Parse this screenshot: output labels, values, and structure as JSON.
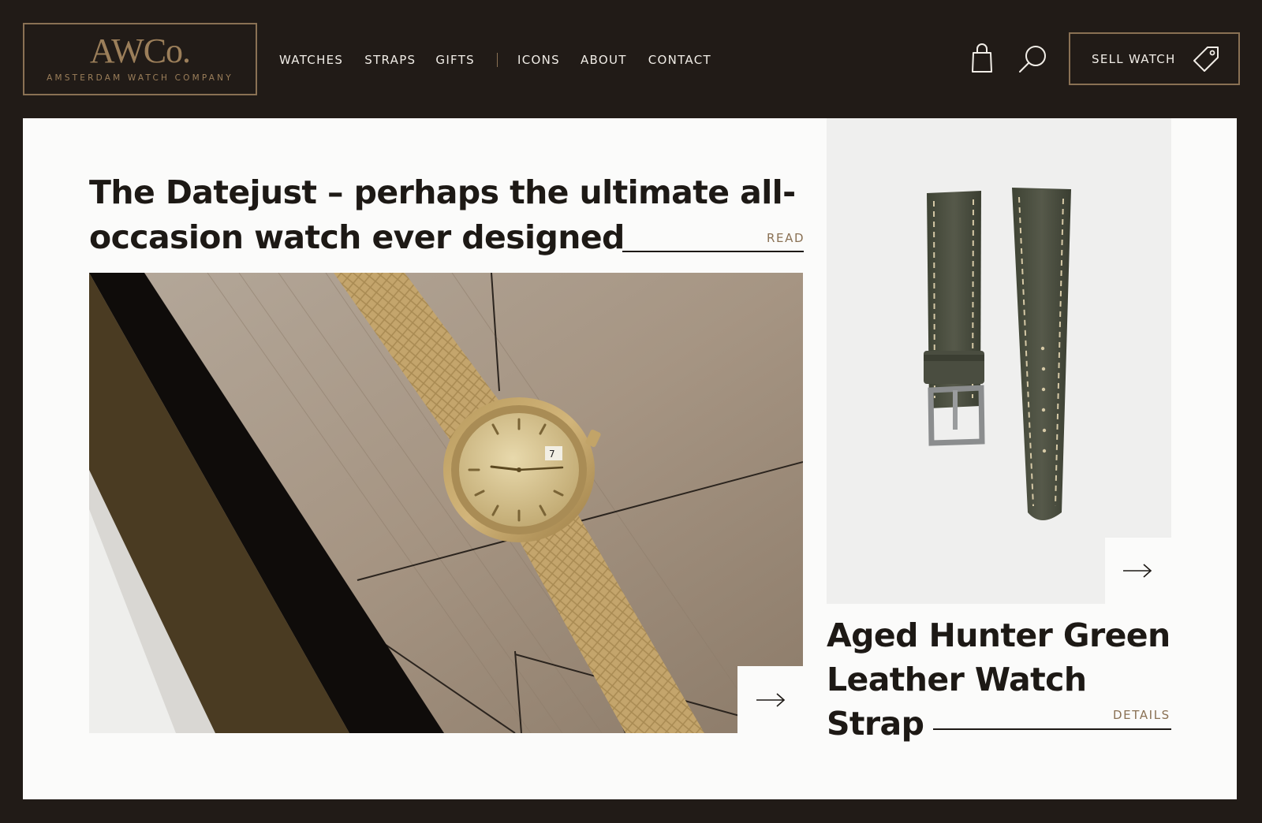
{
  "brand": {
    "logo_text": "AWCo.",
    "logo_subtitle": "AMSTERDAM WATCH COMPANY"
  },
  "nav": {
    "items": [
      {
        "label": "WATCHES"
      },
      {
        "label": "STRAPS"
      },
      {
        "label": "GIFTS"
      },
      {
        "label": "ICONS"
      },
      {
        "label": "ABOUT"
      },
      {
        "label": "CONTACT"
      }
    ]
  },
  "header_actions": {
    "cart_icon": "shopping-bag-icon",
    "search_icon": "search-icon",
    "sell_label": "SELL WATCH",
    "sell_icon": "price-tag-icon"
  },
  "feature_article": {
    "title": "The Datejust – perhaps the ultimate all-occasion watch ever designed",
    "link_label": "READ",
    "image": "gold Rolex Datejust on a wooden table",
    "arrow_icon": "arrow-right-icon"
  },
  "feature_product": {
    "title": "Aged Hunter Green Leather Watch Strap",
    "link_label": "DETAILS",
    "image": "green leather watch strap",
    "arrow_icon": "arrow-right-icon"
  },
  "colors": {
    "background": "#211b17",
    "accent": "#8a7154",
    "card": "#fbfbfa",
    "text": "#1d1915"
  }
}
